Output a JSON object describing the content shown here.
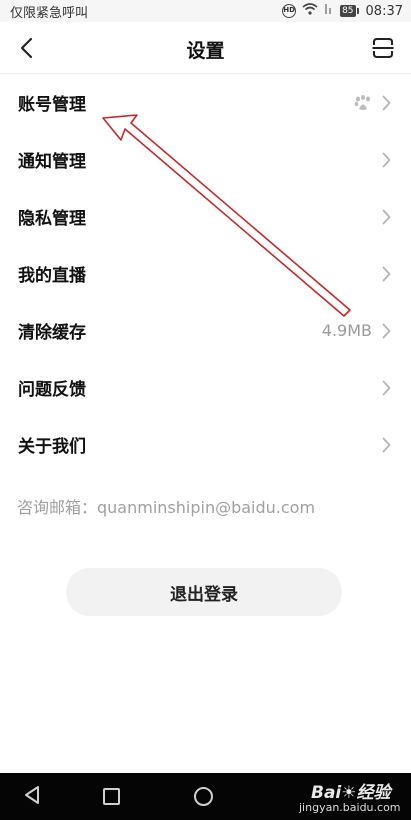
{
  "status_bar": {
    "carrier_text": "仅限紧急呼叫",
    "hd_label": "HD",
    "battery_level": "85",
    "time": "08:37"
  },
  "header": {
    "title": "设置"
  },
  "menu": {
    "items": [
      {
        "label": "账号管理",
        "value": "",
        "icon": "baidu-paw-icon"
      },
      {
        "label": "通知管理",
        "value": ""
      },
      {
        "label": "隐私管理",
        "value": ""
      },
      {
        "label": "我的直播",
        "value": ""
      },
      {
        "label": "清除缓存",
        "value": "4.9MB"
      },
      {
        "label": "问题反馈",
        "value": ""
      },
      {
        "label": "关于我们",
        "value": ""
      }
    ]
  },
  "contact_text": "咨询邮箱：quanminshipin@baidu.com",
  "logout_label": "退出登录",
  "watermark": {
    "logo_text": "Bai",
    "logo_text_2": "经验",
    "domain": "jingyan.baidu.com"
  },
  "colors": {
    "annotation_arrow": "#c62828",
    "secondary_text": "#9a9a9a",
    "button_bg": "#f2f2f2",
    "navbar_bg": "#050505"
  }
}
